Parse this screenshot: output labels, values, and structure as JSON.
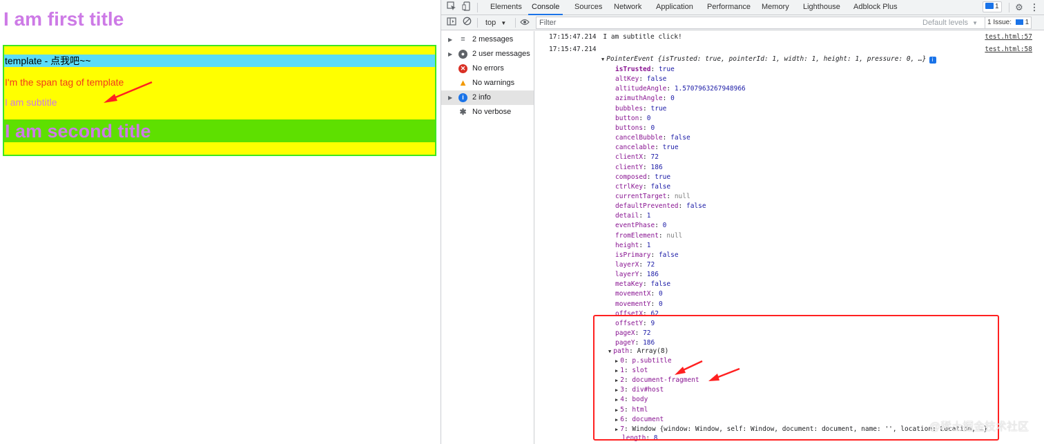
{
  "webpage": {
    "first_title": "I am first title",
    "template_heading": "template - 点我吧~~",
    "template_span": "I'm the span tag of template",
    "subtitle": "I am subtitle",
    "second_title": "I am second title"
  },
  "devtools": {
    "tabs": [
      "Elements",
      "Console",
      "Sources",
      "Network",
      "Application",
      "Performance",
      "Memory",
      "Lighthouse",
      "Adblock Plus"
    ],
    "active_tab": "Console",
    "messages_badge": "1",
    "context": "top",
    "filter_placeholder": "Filter",
    "default_levels": "Default levels",
    "issues": "1 Issue:",
    "issues_count": "1",
    "sidebar": [
      {
        "label": "2 messages",
        "icon": "list-icon"
      },
      {
        "label": "2 user messages",
        "icon": "user-icon"
      },
      {
        "label": "No errors",
        "icon": "error-icon"
      },
      {
        "label": "No warnings",
        "icon": "warning-icon"
      },
      {
        "label": "2 info",
        "icon": "info-icon"
      },
      {
        "label": "No verbose",
        "icon": "bug-icon"
      }
    ],
    "log1": {
      "time": "17:15:47.214",
      "text": "I am subtitle click!",
      "source": "test.html:57"
    },
    "log2": {
      "time": "17:15:47.214",
      "source": "test.html:58",
      "header": "PointerEvent {isTrusted: true, pointerId: 1, width: 1, height: 1, pressure: 0, …}"
    },
    "props": [
      {
        "k": "isTrusted",
        "v": "true",
        "t": "bool",
        "bold": true
      },
      {
        "k": "altKey",
        "v": "false",
        "t": "bool"
      },
      {
        "k": "altitudeAngle",
        "v": "1.5707963267948966",
        "t": "num"
      },
      {
        "k": "azimuthAngle",
        "v": "0",
        "t": "num"
      },
      {
        "k": "bubbles",
        "v": "true",
        "t": "bool"
      },
      {
        "k": "button",
        "v": "0",
        "t": "num"
      },
      {
        "k": "buttons",
        "v": "0",
        "t": "num"
      },
      {
        "k": "cancelBubble",
        "v": "false",
        "t": "bool"
      },
      {
        "k": "cancelable",
        "v": "true",
        "t": "bool"
      },
      {
        "k": "clientX",
        "v": "72",
        "t": "num"
      },
      {
        "k": "clientY",
        "v": "186",
        "t": "num"
      },
      {
        "k": "composed",
        "v": "true",
        "t": "bool"
      },
      {
        "k": "ctrlKey",
        "v": "false",
        "t": "bool"
      },
      {
        "k": "currentTarget",
        "v": "null",
        "t": "null"
      },
      {
        "k": "defaultPrevented",
        "v": "false",
        "t": "bool"
      },
      {
        "k": "detail",
        "v": "1",
        "t": "num"
      },
      {
        "k": "eventPhase",
        "v": "0",
        "t": "num"
      },
      {
        "k": "fromElement",
        "v": "null",
        "t": "null"
      },
      {
        "k": "height",
        "v": "1",
        "t": "num"
      },
      {
        "k": "isPrimary",
        "v": "false",
        "t": "bool"
      },
      {
        "k": "layerX",
        "v": "72",
        "t": "num"
      },
      {
        "k": "layerY",
        "v": "186",
        "t": "num"
      },
      {
        "k": "metaKey",
        "v": "false",
        "t": "bool"
      },
      {
        "k": "movementX",
        "v": "0",
        "t": "num"
      },
      {
        "k": "movementY",
        "v": "0",
        "t": "num"
      },
      {
        "k": "offsetX",
        "v": "62",
        "t": "num"
      },
      {
        "k": "offsetY",
        "v": "9",
        "t": "num"
      },
      {
        "k": "pageX",
        "v": "72",
        "t": "num"
      },
      {
        "k": "pageY",
        "v": "186",
        "t": "num"
      }
    ],
    "path_label": "path",
    "path_value": "Array(8)",
    "path_items": [
      {
        "i": "0",
        "v": "p.subtitle"
      },
      {
        "i": "1",
        "v": "slot"
      },
      {
        "i": "2",
        "v": "document-fragment"
      },
      {
        "i": "3",
        "v": "div#host"
      },
      {
        "i": "4",
        "v": "body"
      },
      {
        "i": "5",
        "v": "html"
      },
      {
        "i": "6",
        "v": "document"
      },
      {
        "i": "7",
        "v": "Window {window: Window, self: Window, document: document, name: '', location: Location, …}"
      }
    ],
    "length_row": {
      "k": "length",
      "v": "8"
    }
  },
  "watermark": "@稀土掘金技术社区",
  "colors": {
    "title": "#cd7ae6",
    "host_bg": "#ffff00",
    "host_border": "#3fe61f",
    "template_bg": "#5bdcf8",
    "span_text": "#f23a1c",
    "second_band": "#5ee000",
    "annotation_red": "#ff2020"
  }
}
